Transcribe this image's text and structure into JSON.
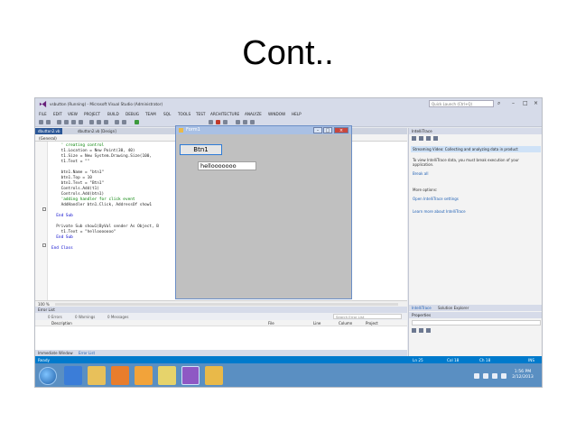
{
  "slide": {
    "title": "Cont.."
  },
  "vs": {
    "window_title": "vsbutton (Running) - Microsoft Visual Studio (Administrator)",
    "quick_launch_placeholder": "Quick Launch (Ctrl+Q)",
    "menu": [
      "FILE",
      "EDIT",
      "VIEW",
      "PROJECT",
      "BUILD",
      "DEBUG",
      "TEAM",
      "SQL",
      "TOOLS",
      "TEST",
      "ARCHITECTURE",
      "ANALYZE",
      "WINDOW",
      "HELP"
    ],
    "tabs": [
      {
        "label": "dbutton2.vb"
      },
      {
        "label": "dbutton2.vb [Design]"
      }
    ],
    "code_nav": "(General)",
    "code": [
      {
        "text": "    ' creating control",
        "kind": "comment"
      },
      {
        "text": "    t1.Location = New Point(30, 40)",
        "kind": "normal"
      },
      {
        "text": "    t1.Size = New System.Drawing.Size(100,",
        "kind": "normal"
      },
      {
        "text": "    t1.Text = \"\"",
        "kind": "normal"
      },
      {
        "text": "",
        "kind": "normal"
      },
      {
        "text": "    btn1.Name = \"btn1\"",
        "kind": "normal"
      },
      {
        "text": "    btn1.Top = 10",
        "kind": "normal"
      },
      {
        "text": "    btn1.Text = \"Btn1\"",
        "kind": "normal"
      },
      {
        "text": "    Controls.Add(t1)",
        "kind": "normal"
      },
      {
        "text": "    Controls.Add(btn1)",
        "kind": "normal"
      },
      {
        "text": "    'adding handler for click event",
        "kind": "comment"
      },
      {
        "text": "    AddHandler btn1.Click, AddressOf show1",
        "kind": "normal"
      },
      {
        "text": "",
        "kind": "normal"
      },
      {
        "text": "  End Sub",
        "kind": "keyword"
      },
      {
        "text": "",
        "kind": "normal"
      },
      {
        "text": "  Private Sub show1(ByVal sender As Object, B",
        "kind": "normal"
      },
      {
        "text": "    t1.Text = \"hellooooooo\"",
        "kind": "normal"
      },
      {
        "text": "  End Sub",
        "kind": "keyword"
      },
      {
        "text": "",
        "kind": "normal"
      },
      {
        "text": "End Class",
        "kind": "keyword"
      }
    ],
    "zoom": "100 %",
    "form": {
      "title": "Form1",
      "button_label": "Btn1",
      "textbox_value": "hellooooooo"
    },
    "error_list": {
      "title": "Error List",
      "filters": [
        "0 Errors",
        "0 Warnings",
        "0 Messages"
      ],
      "search_placeholder": "Search Error List",
      "columns": [
        "Description",
        "File",
        "Line",
        "Column",
        "Project"
      ]
    },
    "bottom_tabs": [
      "Immediate Window",
      "Error List"
    ],
    "intellitrace": {
      "header": "IntelliTrace",
      "event": "Streaming Video: Collecting and analyzing data in product",
      "info": "To view IntelliTrace data, you must break execution of your application.",
      "break_all": "Break all",
      "more_options": "More options:",
      "settings_link": "Open IntelliTrace settings",
      "learn_link": "Learn more about IntelliTrace"
    },
    "right_tabs": [
      "IntelliTrace",
      "Solution Explorer"
    ],
    "properties_header": "Properties",
    "status": {
      "left": "Ready",
      "ln": "Ln 25",
      "col": "Col 18",
      "ch": "Ch 18",
      "mode": "INS"
    },
    "taskbar": {
      "time": "1:56 PM",
      "date": "2/12/2013"
    }
  },
  "colors": {
    "vs_blue": "#007acc",
    "taskbar": "#5a8fc2",
    "comment": "#008000",
    "keyword": "#0000cc"
  }
}
